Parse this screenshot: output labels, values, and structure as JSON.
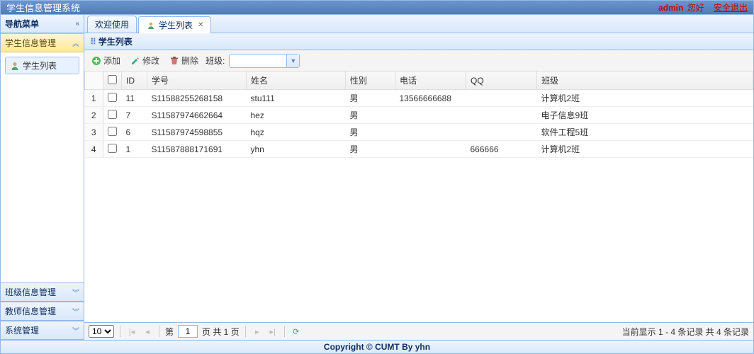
{
  "header": {
    "title": "学生信息管理系统",
    "user": "admin",
    "greeting": "您好",
    "logout": "安全退出"
  },
  "sidebar": {
    "title": "导航菜单",
    "panels": [
      {
        "label": "学生信息管理",
        "expanded": true,
        "items": [
          {
            "label": "学生列表"
          }
        ]
      },
      {
        "label": "班级信息管理",
        "expanded": false
      },
      {
        "label": "教师信息管理",
        "expanded": false
      },
      {
        "label": "系统管理",
        "expanded": false
      }
    ]
  },
  "tabs": [
    {
      "label": "欢迎使用",
      "closable": false,
      "active": false
    },
    {
      "label": "学生列表",
      "closable": true,
      "active": true
    }
  ],
  "panel_title": "学生列表",
  "toolbar": {
    "add": "添加",
    "edit": "修改",
    "del": "删除",
    "class_label": "班级:",
    "class_value": ""
  },
  "columns": [
    "",
    "",
    "ID",
    "学号",
    "姓名",
    "性别",
    "电话",
    "QQ",
    "班级"
  ],
  "rows": [
    {
      "n": "1",
      "id": "11",
      "sno": "S11588255268158",
      "name": "stu111",
      "sex": "男",
      "tel": "13566666688",
      "qq": "",
      "cls": "计算机2班"
    },
    {
      "n": "2",
      "id": "7",
      "sno": "S11587974662664",
      "name": "hez",
      "sex": "男",
      "tel": "",
      "qq": "",
      "cls": "电子信息9班"
    },
    {
      "n": "3",
      "id": "6",
      "sno": "S11587974598855",
      "name": "hqz",
      "sex": "男",
      "tel": "",
      "qq": "",
      "cls": "软件工程5班"
    },
    {
      "n": "4",
      "id": "1",
      "sno": "S11587888171691",
      "name": "yhn",
      "sex": "男",
      "tel": "",
      "qq": "666666",
      "cls": "计算机2班"
    }
  ],
  "pager": {
    "page_size": "10",
    "page_label_before": "第",
    "current_page": "1",
    "page_label_after": "页 共 1 页",
    "info": "当前显示 1 - 4 条记录 共 4 条记录"
  },
  "footer": "Copyright © CUMT By yhn"
}
